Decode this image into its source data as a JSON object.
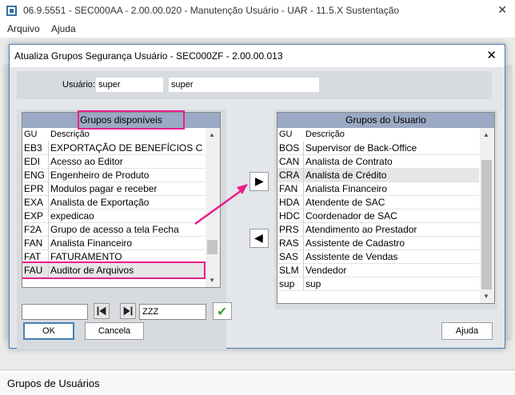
{
  "window": {
    "title": "06.9.5551 - SEC000AA - 2.00.00.020 - Manutenção Usuário - UAR - 11.5.X Sustentação",
    "close": "✕"
  },
  "menu": [
    "Arquivo",
    "Ajuda"
  ],
  "dialog": {
    "title": "Atualiza Grupos Segurança Usuário - SEC000ZF - 2.00.00.013",
    "close": "✕"
  },
  "user": {
    "label": "Usuário:",
    "code": "super",
    "name": "super"
  },
  "available": {
    "header": "Grupos disponíveis",
    "col_gu": "GU",
    "col_desc": "Descrição",
    "rows": [
      {
        "gu": "EB3",
        "desc": "EXPORTAÇÃO DE BENEFÍCIOS CC"
      },
      {
        "gu": "EDI",
        "desc": "Acesso ao Editor"
      },
      {
        "gu": "ENG",
        "desc": "Engenheiro de Produto"
      },
      {
        "gu": "EPR",
        "desc": "Modulos pagar e receber"
      },
      {
        "gu": "EXA",
        "desc": "Analista de Exportação"
      },
      {
        "gu": "EXP",
        "desc": "expedicao"
      },
      {
        "gu": "F2A",
        "desc": "Grupo de acesso a tela Fecha"
      },
      {
        "gu": "FAN",
        "desc": "Analista Financeiro"
      },
      {
        "gu": "FAT",
        "desc": "FATURAMENTO"
      },
      {
        "gu": "FAU",
        "desc": "Auditor de Arquivos"
      }
    ],
    "search_value": "",
    "range_end": "ZZZ",
    "first_icon": "first-page-icon",
    "next_icon": "next-page-icon",
    "confirm_icon": "checkmark-icon"
  },
  "assigned": {
    "header": "Grupos do Usuario",
    "col_gu": "GU",
    "col_desc": "Descrição",
    "rows": [
      {
        "gu": "BOS",
        "desc": "Supervisor de Back-Office"
      },
      {
        "gu": "CAN",
        "desc": "Analista de Contrato"
      },
      {
        "gu": "CRA",
        "desc": "Analista de Crédito"
      },
      {
        "gu": "FAN",
        "desc": "Analista Financeiro"
      },
      {
        "gu": "HDA",
        "desc": "Atendente de SAC"
      },
      {
        "gu": "HDC",
        "desc": "Coordenador de SAC"
      },
      {
        "gu": "PRS",
        "desc": "Atendimento ao Prestador"
      },
      {
        "gu": "RAS",
        "desc": "Assistente de Cadastro"
      },
      {
        "gu": "SAS",
        "desc": "Assistente de Vendas"
      },
      {
        "gu": "SLM",
        "desc": "Vendedor"
      },
      {
        "gu": "sup",
        "desc": "sup"
      }
    ]
  },
  "buttons": {
    "add": "▶",
    "remove": "◀",
    "ok": "OK",
    "cancel": "Cancela",
    "help": "Ajuda",
    "check": "✔"
  },
  "status": "Grupos de Usuários",
  "colors": {
    "highlight": "#e91e8c",
    "list_header": "#9aa9c4",
    "selected_row": "#e6e6e6"
  }
}
